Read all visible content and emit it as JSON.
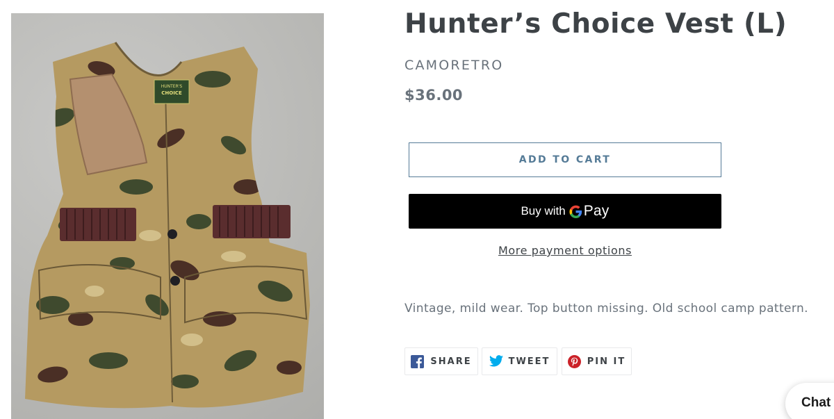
{
  "product": {
    "title": "Hunter’s Choice Vest (L)",
    "vendor": "CAMORETRO",
    "price": "$36.00",
    "description": "Vintage, mild wear. Top button missing. Old school camp pattern.",
    "image_label_line1": "HUNTER'S",
    "image_label_line2": "CHOICE"
  },
  "buttons": {
    "add_to_cart": "ADD TO CART",
    "buy_with": "Buy with",
    "pay": "Pay",
    "more_payment": "More payment options"
  },
  "share": {
    "facebook": "SHARE",
    "twitter": "TWEET",
    "pinterest": "PIN IT"
  },
  "chat": {
    "label": "Chat"
  },
  "colors": {
    "text": "#3d4246",
    "muted": "#69727b",
    "accent": "#557b97",
    "facebook": "#3b5998",
    "twitter": "#00aced",
    "pinterest": "#cb2128"
  }
}
